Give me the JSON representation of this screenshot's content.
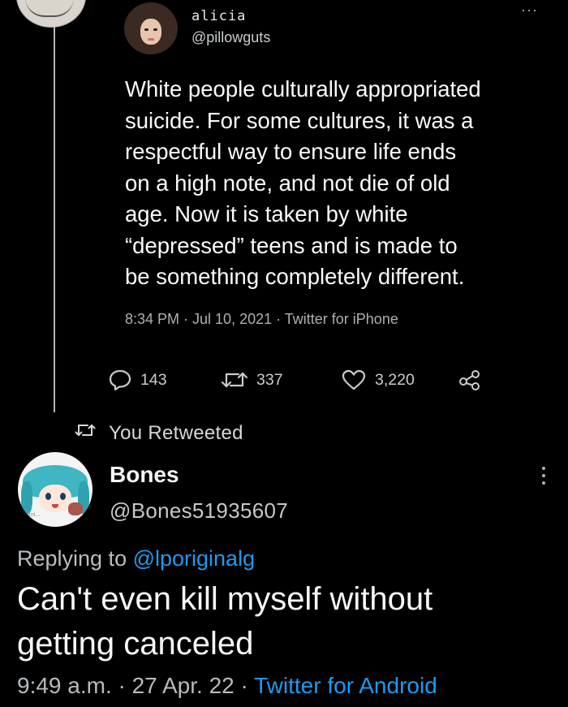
{
  "tweet1": {
    "name": "alicia",
    "handle": "@pillowguts",
    "more_label": "···",
    "body_lines": [
      "White people culturally appropriated",
      "suicide. For some cultures, it was a",
      "respectful way to ensure life ends",
      "on a high note, and not die of old",
      "age. Now it is taken by white",
      "“depressed” teens and is made to",
      "be something completely different."
    ],
    "meta": "8:34 PM · Jul 10, 2021 · Twitter for iPhone",
    "actions": {
      "reply_count": "143",
      "retweet_count": "337",
      "like_count": "3,220"
    }
  },
  "retweeted_label": "You Retweeted",
  "tweet2": {
    "name": "Bones",
    "handle": "@Bones51935607",
    "avatar_tag": "ami...",
    "replying_prefix": "Replying to ",
    "replying_mention": "@lporiginalg",
    "body_lines": [
      "Can't even kill myself without",
      "getting canceled"
    ],
    "meta_time": "9:49 a.m. · 27 Apr. 22 · ",
    "meta_source": "Twitter for Android"
  },
  "colors": {
    "background": "#000000",
    "text": "#e7e9ea",
    "secondary": "#b6bbbf",
    "link": "#1d9bf0"
  }
}
